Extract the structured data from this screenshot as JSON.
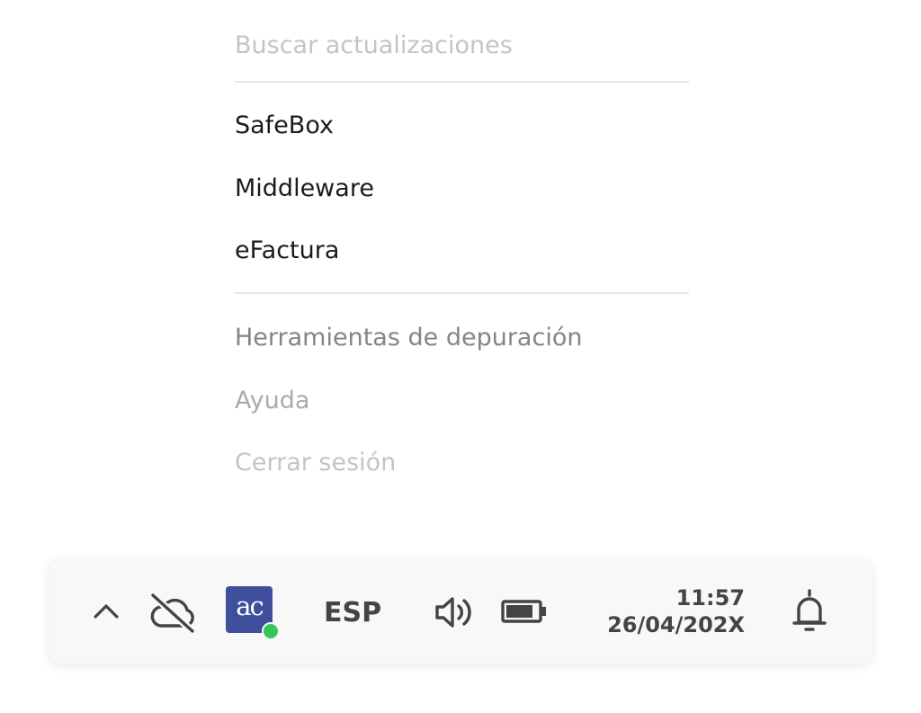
{
  "menu": {
    "check_updates": "Buscar actualizaciones",
    "apps": [
      {
        "label": "SafeBox"
      },
      {
        "label": "Middleware"
      },
      {
        "label": "eFactura"
      }
    ],
    "debug_tools": "Herramientas de depuración",
    "help": "Ayuda",
    "logout": "Cerrar sesión"
  },
  "taskbar": {
    "icons": {
      "expand": "chevron-up-icon",
      "cloud": "cloud-off-icon",
      "app": "ac-app-icon",
      "volume": "volume-icon",
      "battery": "battery-icon",
      "notifications": "bell-icon"
    },
    "app_logo_text": "ac",
    "app_status_color": "#36c657",
    "app_logo_color": "#3f4f9c",
    "language": "ESP",
    "time": "11:57",
    "date": "26/04/202X"
  }
}
